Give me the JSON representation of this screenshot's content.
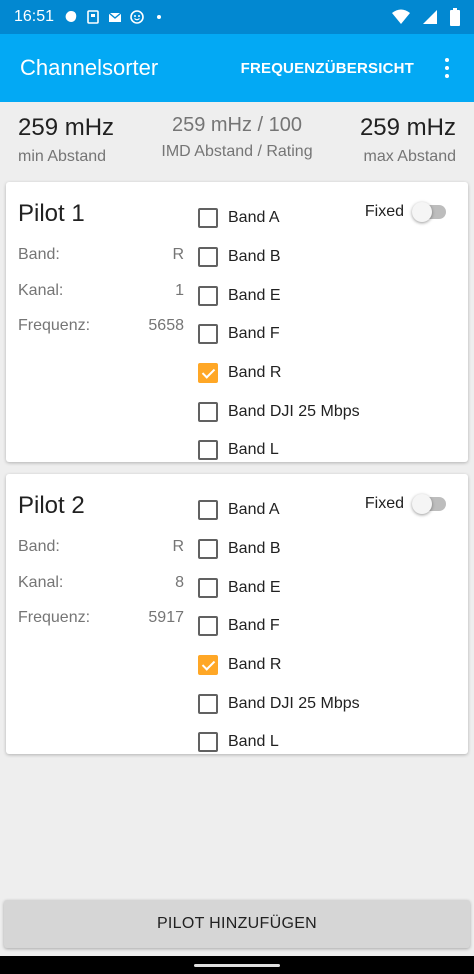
{
  "status_bar": {
    "time": "16:51",
    "icons_left": [
      "blob-icon",
      "sd-card-icon",
      "mail-icon",
      "face-icon",
      "dot-icon"
    ],
    "icons_right": [
      "wifi-icon",
      "signal-icon",
      "battery-icon"
    ]
  },
  "app_bar": {
    "title": "Channelsorter",
    "action": "FREQUENZÜBERSICHT",
    "overflow_icon": "more-vert-icon"
  },
  "summary": {
    "min_value": "259 mHz",
    "min_label": "min Abstand",
    "imd_value": "259 mHz / 100",
    "imd_label": "IMD Abstand / Rating",
    "max_value": "259 mHz",
    "max_label": "max Abstand"
  },
  "pilots": [
    {
      "name": "Pilot 1",
      "band_label": "Band:",
      "band_value": "R",
      "kanal_label": "Kanal:",
      "kanal_value": "1",
      "freq_label": "Frequenz:",
      "freq_value": "5658",
      "fixed_label": "Fixed",
      "fixed_on": false,
      "bands": [
        {
          "label": "Band A",
          "checked": false
        },
        {
          "label": "Band B",
          "checked": false
        },
        {
          "label": "Band E",
          "checked": false
        },
        {
          "label": "Band F",
          "checked": false
        },
        {
          "label": "Band R",
          "checked": true
        },
        {
          "label": "Band DJI 25 Mbps",
          "checked": false
        },
        {
          "label": "Band L",
          "checked": false
        }
      ]
    },
    {
      "name": "Pilot 2",
      "band_label": "Band:",
      "band_value": "R",
      "kanal_label": "Kanal:",
      "kanal_value": "8",
      "freq_label": "Frequenz:",
      "freq_value": "5917",
      "fixed_label": "Fixed",
      "fixed_on": false,
      "bands": [
        {
          "label": "Band A",
          "checked": false
        },
        {
          "label": "Band B",
          "checked": false
        },
        {
          "label": "Band E",
          "checked": false
        },
        {
          "label": "Band F",
          "checked": false
        },
        {
          "label": "Band R",
          "checked": true
        },
        {
          "label": "Band DJI 25 Mbps",
          "checked": false
        },
        {
          "label": "Band L",
          "checked": false
        }
      ]
    }
  ],
  "add_button": "PILOT HINZUFÜGEN",
  "colors": {
    "status_bar": "#0288d1",
    "app_bar": "#03a9f4",
    "checkbox_checked": "#ffa726",
    "background": "#eeeeee"
  }
}
